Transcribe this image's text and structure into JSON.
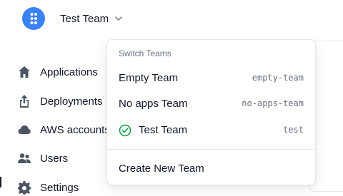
{
  "brand": {
    "logo_icon": "dots-logo-icon",
    "accent": "#3b82f6"
  },
  "team_switcher": {
    "current_team": "Test Team",
    "chevron_icon": "chevron-down-icon"
  },
  "sidebar": {
    "items": [
      {
        "label": "Applications",
        "icon": "home-icon"
      },
      {
        "label": "Deployments",
        "icon": "upload-icon"
      },
      {
        "label": "AWS accounts",
        "icon": "cloud-icon"
      },
      {
        "label": "Users",
        "icon": "users-icon"
      },
      {
        "label": "Settings",
        "icon": "gear-icon"
      }
    ]
  },
  "dropdown": {
    "header": "Switch Teams",
    "teams": [
      {
        "name": "Empty Team",
        "slug": "empty-team",
        "selected": false
      },
      {
        "name": "No apps Team",
        "slug": "no-apps-team",
        "selected": false
      },
      {
        "name": "Test Team",
        "slug": "test",
        "selected": true,
        "check_icon": "check-circle-icon",
        "check_color": "#16a34a"
      }
    ],
    "create_label": "Create New Team"
  }
}
